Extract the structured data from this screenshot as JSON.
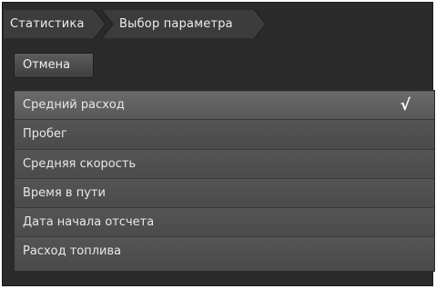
{
  "breadcrumb": {
    "items": [
      {
        "label": "Статистика"
      },
      {
        "label": "Выбор параметра"
      }
    ]
  },
  "cancel_label": "Отмена",
  "options": [
    {
      "label": "Средний расход",
      "selected": true
    },
    {
      "label": "Пробег",
      "selected": false
    },
    {
      "label": "Средняя скорость",
      "selected": false
    },
    {
      "label": "Время в пути",
      "selected": false
    },
    {
      "label": "Дата начала отсчета",
      "selected": false
    },
    {
      "label": "Расход топлива",
      "selected": false
    }
  ],
  "check_mark": "√",
  "colors": {
    "background": "#2b2b2b",
    "item": "#4b4b4b",
    "selected_item": "#5f5f5f",
    "text": "#e8e8e8"
  }
}
